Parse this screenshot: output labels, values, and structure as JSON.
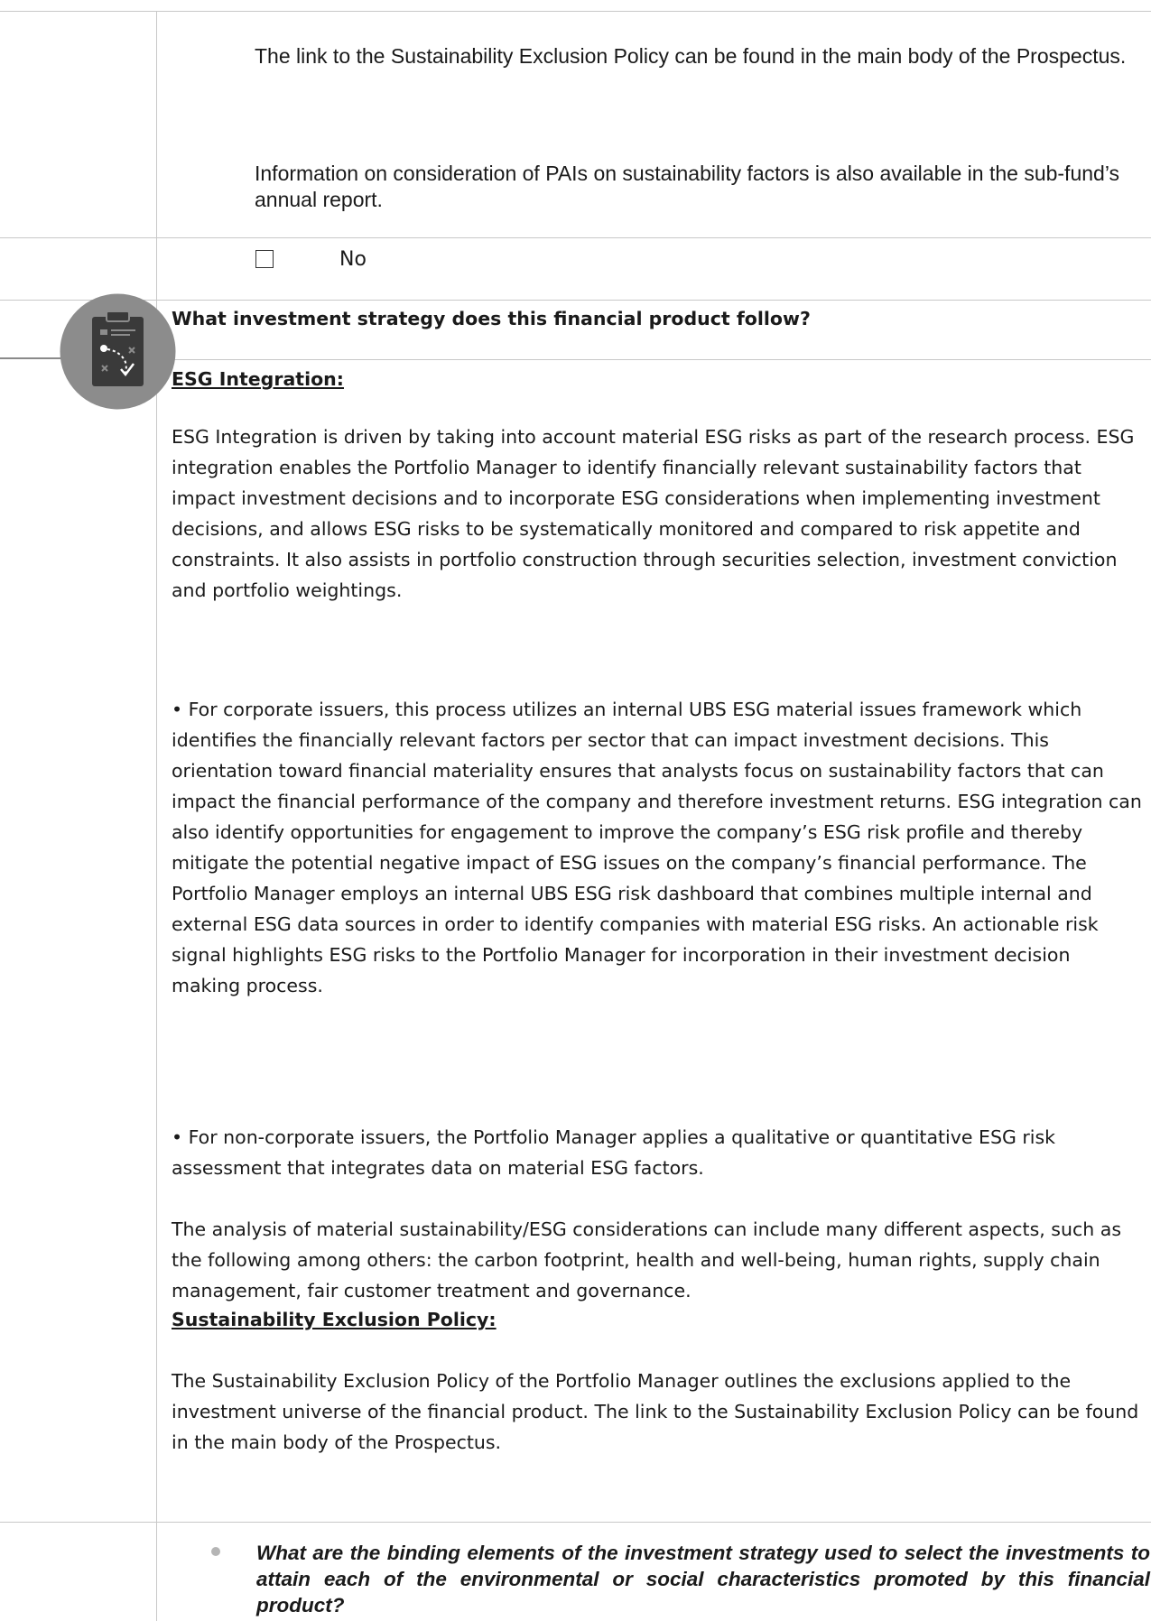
{
  "paragraphs_top": [
    "The link to the Sustainability Exclusion Policy can be found in the main body of the Prospectus.",
    "Information on consideration of PAIs on sustainability factors is also available in the sub-fund’s annual report."
  ],
  "checkbox": {
    "symbol": "☐",
    "label": "No"
  },
  "icon": {
    "name": "strategy-clipboard-icon",
    "circle_color": "#8c8c8c",
    "board_color": "#3a3a3a"
  },
  "section": {
    "question": "What investment strategy does this financial product follow?",
    "esg_heading": "ESG Integration:",
    "esg_paragraphs": [
      "ESG Integration is driven by taking into account material ESG risks as part of the research process. ESG integration enables the Portfolio Manager to identify financially relevant sustainability factors that impact investment decisions and to incorporate ESG considerations when implementing investment decisions, and allows ESG risks to be systematically monitored and compared to risk appetite and constraints. It also assists in portfolio construction through securities selection, investment conviction and portfolio weightings.",
      "• For corporate issuers, this process utilizes an internal UBS ESG material issues framework which identifies the financially relevant factors per sector that can impact investment decisions. This orientation toward financial materiality ensures that analysts focus on sustainability factors that can impact the financial performance of the company and therefore investment returns. ESG integration can also identify opportunities for engagement to improve the company’s ESG risk profile and thereby mitigate the potential negative impact of ESG issues on the company’s financial performance. The Portfolio Manager employs an internal UBS ESG risk dashboard that combines multiple internal and external ESG data sources in order to identify companies with material ESG risks. An actionable risk signal highlights ESG risks to the Portfolio Manager for incorporation in their investment decision making process.",
      "• For non-corporate issuers, the Portfolio Manager applies a qualitative or quantitative ESG risk assessment that integrates data on material ESG factors.",
      "The analysis of material sustainability/ESG considerations can include many different aspects, such as the following among others: the carbon footprint, health and well-being, human rights, supply chain management, fair customer treatment and governance."
    ],
    "exclusion_heading": "Sustainability Exclusion Policy:",
    "exclusion_paragraph": "The Sustainability Exclusion Policy of the Portfolio Manager outlines the exclusions applied to the investment universe of the financial product. The link to the Sustainability Exclusion Policy can be found in the main body of the  Prospectus."
  },
  "binding_question": "What are the binding elements of the investment strategy used to select the investments to attain each of the environmental or social characteristics promoted by this financial product?"
}
